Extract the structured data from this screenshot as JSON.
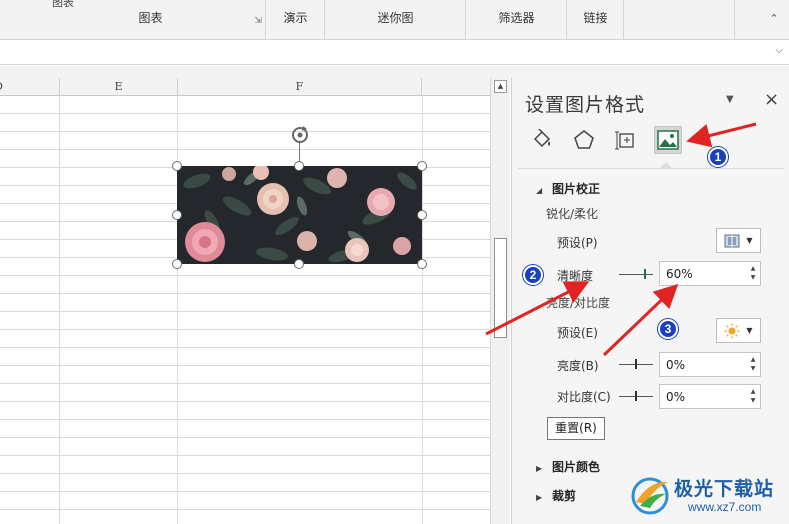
{
  "ribbon": {
    "groups": [
      {
        "label": "图表",
        "top_text": "图表"
      },
      {
        "label": "演示"
      },
      {
        "label": "迷你图"
      },
      {
        "label": "筛选器"
      },
      {
        "label": "链接"
      }
    ],
    "accent": "#217346"
  },
  "sheet": {
    "columns": [
      "D",
      "E",
      "F"
    ]
  },
  "pane": {
    "title": "设置图片格式",
    "tabs": [
      {
        "name": "fill-line",
        "icon": "paint-bucket-icon"
      },
      {
        "name": "effects",
        "icon": "pentagon-icon"
      },
      {
        "name": "size-properties",
        "icon": "size-properties-icon"
      },
      {
        "name": "picture",
        "icon": "picture-icon",
        "selected": true
      }
    ],
    "correction": {
      "header": "图片校正",
      "sharpen_label": "锐化/柔化",
      "preset1_label": "预设(P)",
      "clarity_label": "清晰度",
      "clarity_value": "60%",
      "brightness_section": "亮度/对比度",
      "preset2_label": "预设(E)",
      "brightness_label": "亮度(B)",
      "brightness_value": "0%",
      "contrast_label": "对比度(C)",
      "contrast_value": "0%",
      "reset_label": "重置(R)"
    },
    "color_section": "图片颜色",
    "crop_section": "裁剪"
  },
  "callouts": [
    "1",
    "2",
    "3"
  ],
  "watermark": {
    "title": "极光下载站",
    "url": "www.xz7.com"
  }
}
